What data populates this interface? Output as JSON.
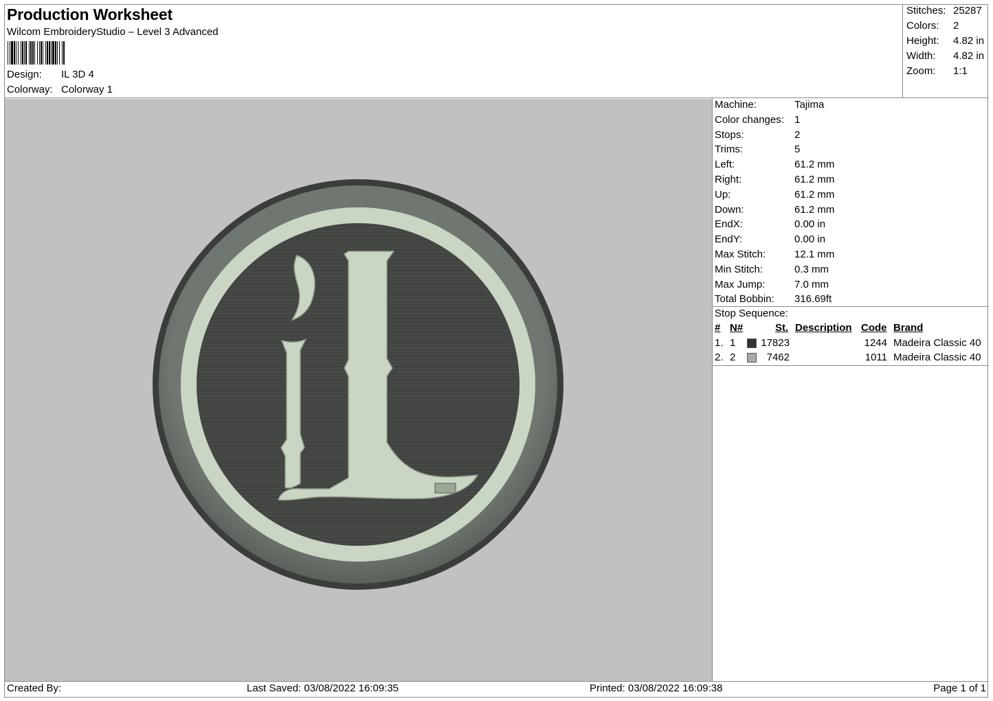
{
  "header": {
    "title": "Production Worksheet",
    "subtitle": "Wilcom EmbroideryStudio – Level 3 Advanced",
    "design_label": "Design:",
    "design_value": "IL 3D 4",
    "colorway_label": "Colorway:",
    "colorway_value": "Colorway 1"
  },
  "summary": [
    {
      "label": "Stitches:",
      "value": "25287"
    },
    {
      "label": "Colors:",
      "value": "2"
    },
    {
      "label": "Height:",
      "value": "4.82 in"
    },
    {
      "label": "Width:",
      "value": "4.82 in"
    },
    {
      "label": "Zoom:",
      "value": "1:1"
    }
  ],
  "details": [
    {
      "label": "Machine:",
      "value": "Tajima"
    },
    {
      "label": "Color changes:",
      "value": "1"
    },
    {
      "label": "Stops:",
      "value": "2"
    },
    {
      "label": "Trims:",
      "value": "5"
    },
    {
      "label": "Left:",
      "value": "61.2 mm"
    },
    {
      "label": "Right:",
      "value": "61.2 mm"
    },
    {
      "label": "Up:",
      "value": "61.2 mm"
    },
    {
      "label": "Down:",
      "value": "61.2 mm"
    },
    {
      "label": "EndX:",
      "value": "0.00 in"
    },
    {
      "label": "EndY:",
      "value": "0.00 in"
    },
    {
      "label": "Max Stitch:",
      "value": "12.1 mm"
    },
    {
      "label": "Min Stitch:",
      "value": "0.3 mm"
    },
    {
      "label": "Max Jump:",
      "value": "7.0 mm"
    },
    {
      "label": "Total Bobbin:",
      "value": "316.69ft"
    }
  ],
  "stop_sequence": {
    "title": "Stop Sequence:",
    "columns": {
      "idx": "#",
      "needle": "N#",
      "stitches": "St.",
      "description": "Description",
      "code": "Code",
      "brand": "Brand"
    },
    "rows": [
      {
        "idx": "1.",
        "needle": "1",
        "color": "#2e3338",
        "stitches": "17823",
        "description": "",
        "code": "1244",
        "brand": "Madeira Classic 40"
      },
      {
        "idx": "2.",
        "needle": "2",
        "color": "#a9a9a9",
        "stitches": "7462",
        "description": "",
        "code": "1011",
        "brand": "Madeira Classic 40"
      }
    ]
  },
  "preview": {
    "background": "#c1c1c1",
    "thread_dark": "#3f423f",
    "thread_light": "#c9d6c4"
  },
  "footer": {
    "created_by": "Created By:",
    "last_saved": "Last Saved: 03/08/2022 16:09:35",
    "printed": "Printed: 03/08/2022 16:09:38",
    "page": "Page 1 of 1"
  }
}
